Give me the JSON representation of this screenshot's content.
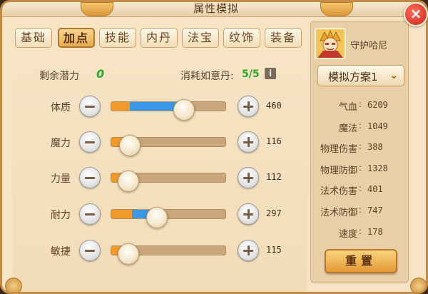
{
  "window": {
    "title": "属性模拟",
    "close_label": "×"
  },
  "tabs": [
    {
      "label": "基础",
      "active": false
    },
    {
      "label": "加点",
      "active": true
    },
    {
      "label": "技能",
      "active": false
    },
    {
      "label": "内丹",
      "active": false
    },
    {
      "label": "法宝",
      "active": false
    },
    {
      "label": "纹饰",
      "active": false
    },
    {
      "label": "装备",
      "active": false
    }
  ],
  "points": {
    "remaining_label": "剩余潜力",
    "remaining_value": "0",
    "pill_label": "消耗如意丹:",
    "pill_value": "5/5",
    "info_label": "i"
  },
  "attributes": [
    {
      "label": "体质",
      "value": "460",
      "base_fraction": 0.16,
      "total_fraction": 0.64
    },
    {
      "label": "魔力",
      "value": "116",
      "base_fraction": 0.16,
      "total_fraction": 0.16
    },
    {
      "label": "力量",
      "value": "112",
      "base_fraction": 0.15,
      "total_fraction": 0.15
    },
    {
      "label": "耐力",
      "value": "297",
      "base_fraction": 0.18,
      "total_fraction": 0.4
    },
    {
      "label": "敏捷",
      "value": "115",
      "base_fraction": 0.15,
      "total_fraction": 0.15
    }
  ],
  "character": {
    "name": "守护哈尼",
    "avatar_icon": "character-portrait-icon"
  },
  "plan": {
    "label": "模拟方案1",
    "icon": "chevron-down-icon"
  },
  "stats": [
    {
      "label": "气血",
      "value": "6209"
    },
    {
      "label": "魔法",
      "value": "1049"
    },
    {
      "label": "物理伤害",
      "value": "388"
    },
    {
      "label": "物理防御",
      "value": "1328"
    },
    {
      "label": "法术伤害",
      "value": "401"
    },
    {
      "label": "法术防御",
      "value": "747"
    },
    {
      "label": "速度",
      "value": "178"
    }
  ],
  "stat_separator": ":",
  "reset_label": "重置",
  "colors": {
    "base_fill": "#f09a2c",
    "extra_fill": "#3a98e4",
    "highlight_value": "#2ca62c"
  }
}
